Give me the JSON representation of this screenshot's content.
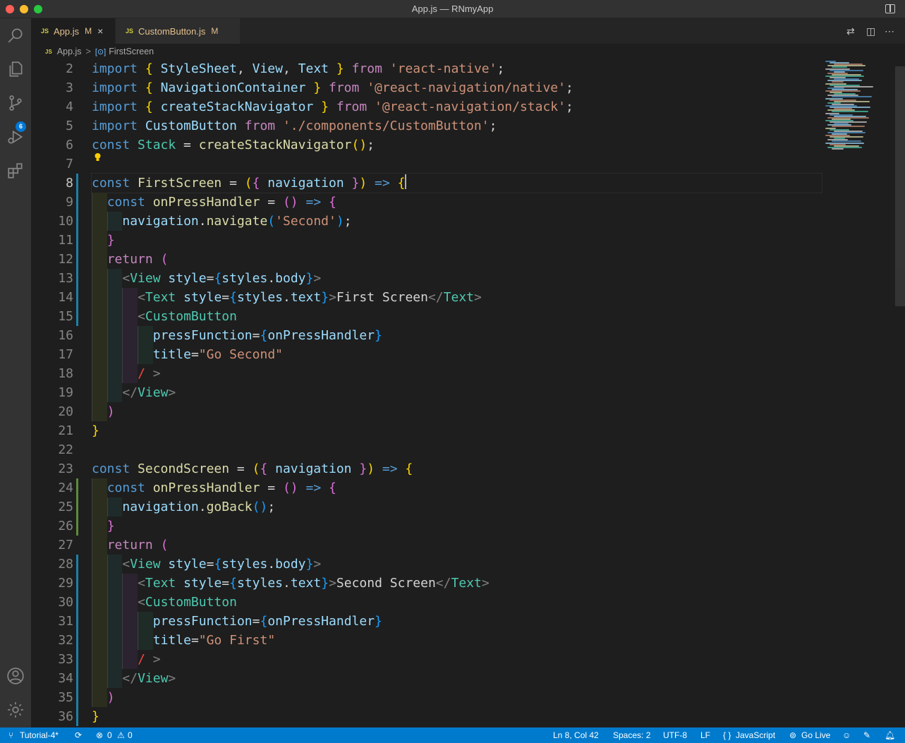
{
  "window": {
    "title": "App.js — RNmyApp"
  },
  "colors": {
    "statusbar": "#007acc",
    "editor_bg": "#1e1e1e",
    "sidebar_bg": "#333333"
  },
  "activity": {
    "scm_badge": "6"
  },
  "tabs": [
    {
      "lang": "JS",
      "name": "App.js",
      "status": "M",
      "close": "×"
    },
    {
      "lang": "JS",
      "name": "CustomButton.js",
      "status": "M"
    }
  ],
  "breadcrumb": {
    "lang": "JS",
    "file": "App.js",
    "separator": ">",
    "symbol": "FirstScreen"
  },
  "editor": {
    "line_numbers": [
      "2",
      "3",
      "4",
      "5",
      "6",
      "7",
      "8",
      "9",
      "10",
      "11",
      "12",
      "13",
      "14",
      "15",
      "16",
      "17",
      "18",
      "19",
      "20",
      "21",
      "22",
      "23",
      "24",
      "25",
      "26",
      "27",
      "28",
      "29",
      "30",
      "31",
      "32",
      "33",
      "34",
      "35",
      "36"
    ],
    "active_line": "8"
  },
  "status": {
    "branch": "Tutorial-4*",
    "errors": "0",
    "warnings": "0",
    "position": "Ln 8, Col 42",
    "spaces": "Spaces: 2",
    "encoding": "UTF-8",
    "eol": "LF",
    "language": "JavaScript",
    "golive": "Go Live"
  }
}
